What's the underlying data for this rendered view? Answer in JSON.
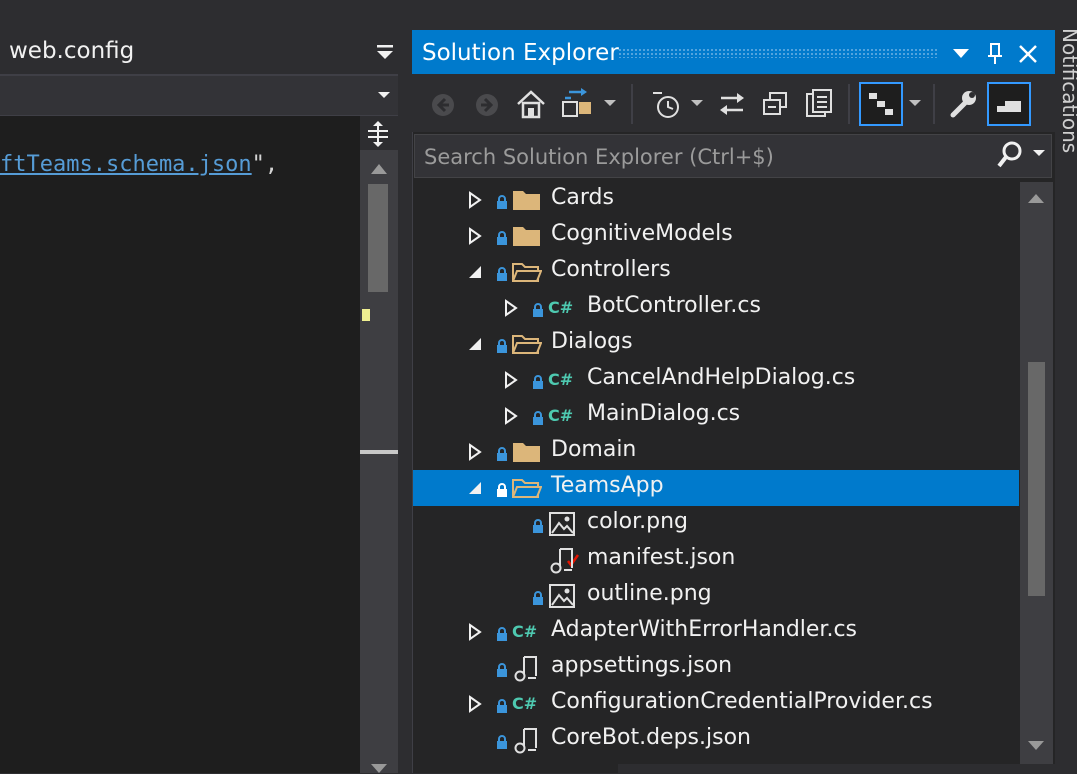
{
  "editor": {
    "tab_title": "web.config",
    "code_prefix": "ftTeams.schema.json",
    "code_suffix": "\",",
    "code_quote_after": ""
  },
  "solution_explorer": {
    "title": "Solution Explorer",
    "search_placeholder": "Search Solution Explorer (Ctrl+$)",
    "tree": [
      {
        "label": "Cards",
        "type": "folder",
        "expanded": false,
        "depth": 0
      },
      {
        "label": "CognitiveModels",
        "type": "folder",
        "expanded": false,
        "depth": 0
      },
      {
        "label": "Controllers",
        "type": "folder",
        "expanded": true,
        "depth": 0
      },
      {
        "label": "BotController.cs",
        "type": "csharp",
        "expanded": false,
        "depth": 1
      },
      {
        "label": "Dialogs",
        "type": "folder",
        "expanded": true,
        "depth": 0
      },
      {
        "label": "CancelAndHelpDialog.cs",
        "type": "csharp",
        "expanded": false,
        "depth": 1
      },
      {
        "label": "MainDialog.cs",
        "type": "csharp",
        "expanded": false,
        "depth": 1
      },
      {
        "label": "Domain",
        "type": "folder",
        "expanded": false,
        "depth": 0
      },
      {
        "label": "TeamsApp",
        "type": "folder",
        "expanded": true,
        "depth": 0,
        "selected": true
      },
      {
        "label": "color.png",
        "type": "image",
        "depth": 1
      },
      {
        "label": "manifest.json",
        "type": "json",
        "depth": 1,
        "checked": true
      },
      {
        "label": "outline.png",
        "type": "image",
        "depth": 1
      },
      {
        "label": "AdapterWithErrorHandler.cs",
        "type": "csharp",
        "expanded": false,
        "depth": 0
      },
      {
        "label": "appsettings.json",
        "type": "json",
        "depth": 0
      },
      {
        "label": "ConfigurationCredentialProvider.cs",
        "type": "csharp",
        "expanded": false,
        "depth": 0
      },
      {
        "label": "CoreBot.deps.json",
        "type": "json",
        "depth": 0
      }
    ]
  },
  "side_tab": "Notifications",
  "colors": {
    "accent": "#007acc",
    "folder": "#dcb67a",
    "csharp": "#4ec9b0",
    "lock": "#3b95db",
    "check": "#e51400"
  }
}
